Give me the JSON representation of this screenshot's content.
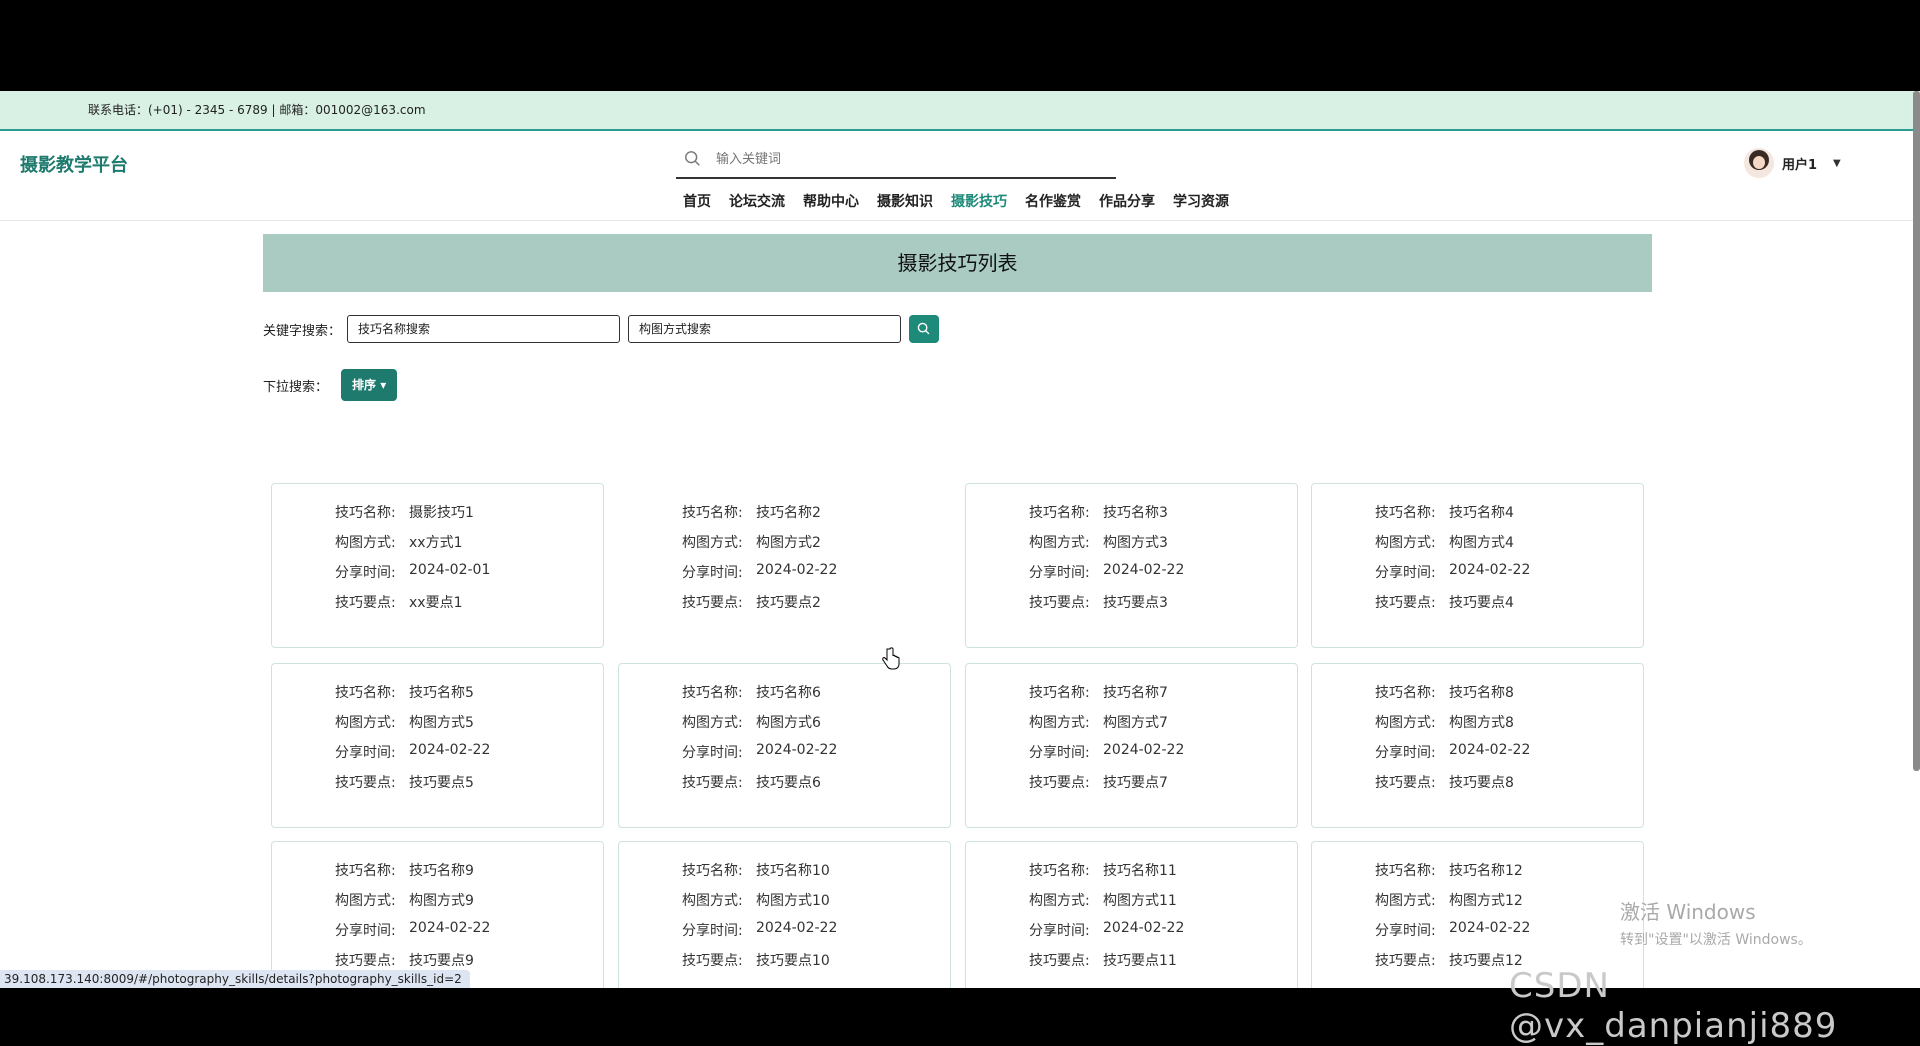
{
  "topbar": {
    "contact": "联系电话：(+01) - 2345 - 6789 | 邮箱：001002@163.com"
  },
  "header": {
    "brand": "摄影教学平台",
    "search_placeholder": "输入关键词",
    "user_name": "用户1"
  },
  "nav": [
    {
      "label": "首页",
      "active": false
    },
    {
      "label": "论坛交流",
      "active": false
    },
    {
      "label": "帮助中心",
      "active": false
    },
    {
      "label": "摄影知识",
      "active": false
    },
    {
      "label": "摄影技巧",
      "active": true
    },
    {
      "label": "名作鉴赏",
      "active": false
    },
    {
      "label": "作品分享",
      "active": false
    },
    {
      "label": "学习资源",
      "active": false
    }
  ],
  "banner": {
    "title": "摄影技巧列表"
  },
  "search": {
    "label": "关键字搜索：",
    "name_value": "技巧名称搜索",
    "method_value": "构图方式搜索"
  },
  "dropdown": {
    "label": "下拉搜索：",
    "button": "排序"
  },
  "field_labels": {
    "name": "技巧名称:",
    "method": "构图方式:",
    "time": "分享时间:",
    "point": "技巧要点:"
  },
  "cards": [
    {
      "name": "摄影技巧1",
      "method": "xx方式1",
      "time": "2024-02-01",
      "point": "xx要点1"
    },
    {
      "name": "技巧名称2",
      "method": "构图方式2",
      "time": "2024-02-22",
      "point": "技巧要点2"
    },
    {
      "name": "技巧名称3",
      "method": "构图方式3",
      "time": "2024-02-22",
      "point": "技巧要点3"
    },
    {
      "name": "技巧名称4",
      "method": "构图方式4",
      "time": "2024-02-22",
      "point": "技巧要点4"
    },
    {
      "name": "技巧名称5",
      "method": "构图方式5",
      "time": "2024-02-22",
      "point": "技巧要点5"
    },
    {
      "name": "技巧名称6",
      "method": "构图方式6",
      "time": "2024-02-22",
      "point": "技巧要点6"
    },
    {
      "name": "技巧名称7",
      "method": "构图方式7",
      "time": "2024-02-22",
      "point": "技巧要点7"
    },
    {
      "name": "技巧名称8",
      "method": "构图方式8",
      "time": "2024-02-22",
      "point": "技巧要点8"
    },
    {
      "name": "技巧名称9",
      "method": "构图方式9",
      "time": "2024-02-22",
      "point": "技巧要点9"
    },
    {
      "name": "技巧名称10",
      "method": "构图方式10",
      "time": "2024-02-22",
      "point": "技巧要点10"
    },
    {
      "name": "技巧名称11",
      "method": "构图方式11",
      "time": "2024-02-22",
      "point": "技巧要点11"
    },
    {
      "name": "技巧名称12",
      "method": "构图方式12",
      "time": "2024-02-22",
      "point": "技巧要点12"
    }
  ],
  "status_url": "39.108.173.140:8009/#/photography_skills/details?photography_skills_id=2",
  "watermark": {
    "line1": "激活 Windows",
    "line2": "转到\"设置\"以激活 Windows。"
  },
  "csdn": "CSDN @vx_danpianji889",
  "colors": {
    "accent": "#1e8a7a",
    "topbar": "#d8f1e4",
    "banner": "#a9cbc2"
  }
}
